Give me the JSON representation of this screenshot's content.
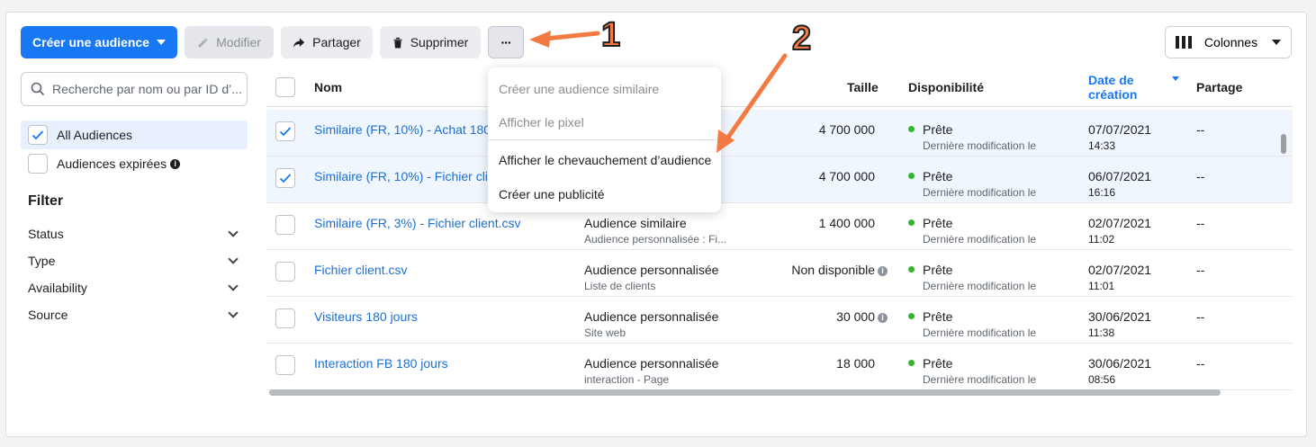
{
  "toolbar": {
    "create_label": "Créer une audience",
    "edit_label": "Modifier",
    "share_label": "Partager",
    "delete_label": "Supprimer",
    "more_label": "···",
    "columns_label": "Colonnes"
  },
  "sidebar": {
    "search_placeholder": "Recherche par nom ou par ID d’...",
    "all_audiences": "All Audiences",
    "expired_audiences": "Audiences expirées",
    "filter_title": "Filter",
    "filters": [
      "Status",
      "Type",
      "Availability",
      "Source"
    ]
  },
  "menu": {
    "items": [
      {
        "label": "Créer une audience similaire",
        "disabled": true
      },
      {
        "label": "Afficher le pixel",
        "disabled": true
      },
      {
        "label": "Afficher le chevauchement d’audience",
        "disabled": false
      },
      {
        "label": "Créer une publicité",
        "disabled": false
      }
    ]
  },
  "table": {
    "headers": {
      "name": "Nom",
      "size": "Taille",
      "availability": "Disponibilité",
      "date_line1": "Date de",
      "date_line2": "création",
      "sharing": "Partage"
    },
    "rows": [
      {
        "name": "Similaire (FR, 10%) - Achat 180",
        "type": "",
        "type_sub": "",
        "size": "4 700 000",
        "size_info": false,
        "status": "Prête",
        "status_sub": "Dernière modification le",
        "date": "07/07/2021",
        "time": "14:33",
        "share": "--",
        "checked": true
      },
      {
        "name": "Similaire (FR, 10%) - Fichier clie",
        "type": "",
        "type_sub": "",
        "size": "4 700 000",
        "size_info": false,
        "status": "Prête",
        "status_sub": "Dernière modification le",
        "date": "06/07/2021",
        "time": "16:16",
        "share": "--",
        "checked": true
      },
      {
        "name": "Similaire (FR, 3%) - Fichier client.csv",
        "type": "Audience similaire",
        "type_sub": "Audience personnalisée : Fi...",
        "size": "1 400 000",
        "size_info": false,
        "status": "Prête",
        "status_sub": "Dernière modification le",
        "date": "02/07/2021",
        "time": "11:02",
        "share": "--",
        "checked": false
      },
      {
        "name": "Fichier client.csv",
        "type": "Audience personnalisée",
        "type_sub": "Liste de clients",
        "size": "Non disponible",
        "size_info": true,
        "status": "Prête",
        "status_sub": "Dernière modification le",
        "date": "02/07/2021",
        "time": "11:01",
        "share": "--",
        "checked": false
      },
      {
        "name": "Visiteurs 180 jours",
        "type": "Audience personnalisée",
        "type_sub": "Site web",
        "size": "30 000",
        "size_info": true,
        "status": "Prête",
        "status_sub": "Dernière modification le",
        "date": "30/06/2021",
        "time": "11:38",
        "share": "--",
        "checked": false
      },
      {
        "name": "Interaction FB 180 jours",
        "type": "Audience personnalisée",
        "type_sub": "interaction - Page",
        "size": "18 000",
        "size_info": false,
        "status": "Prête",
        "status_sub": "Dernière modification le",
        "date": "30/06/2021",
        "time": "08:56",
        "share": "--",
        "checked": false
      }
    ]
  },
  "annotations": {
    "label_1": "1",
    "label_2": "2",
    "color": "#f47a43"
  },
  "colors": {
    "primary": "#1877f2",
    "link": "#1b6fd6",
    "status_ok": "#2eb82e"
  }
}
